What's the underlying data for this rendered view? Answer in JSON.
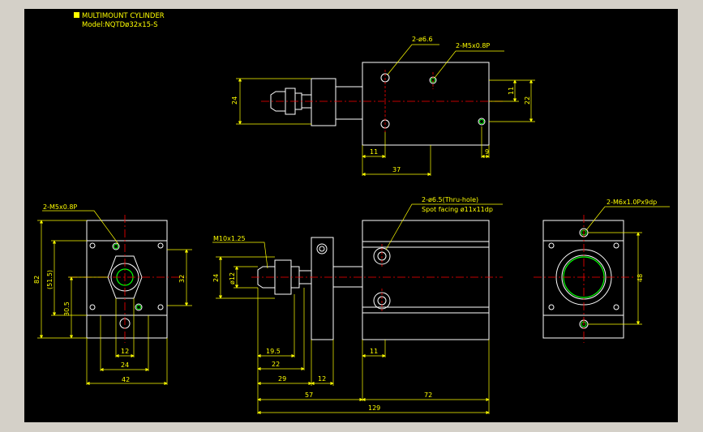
{
  "title": {
    "line1": "MULTIMOUNT CYLINDER",
    "line2": "Model:NQTDø32x15-S"
  },
  "colors": {
    "background": "#000000",
    "outline": "#ffffff",
    "dimension": "#ffff00",
    "centerline": "#ff0000",
    "highlight": "#00ff00",
    "window": "#d4d0c8"
  },
  "top_view": {
    "callout_holes": "2-ø6.6",
    "callout_threads": "2-M5x0.8P",
    "dims": {
      "height_24": "24",
      "d11": "11",
      "d22": "22",
      "left_11": "11",
      "right_9": "9",
      "d37": "37"
    }
  },
  "left_view": {
    "callout": "2-M5x0.8P",
    "dims": {
      "d82": "82",
      "d51_5": "(51.5)",
      "d30_5": "30.5",
      "d32": "32",
      "d12": "12",
      "d24": "24",
      "d42": "42"
    }
  },
  "front_view": {
    "callout_thread": "M10x1.25",
    "callout_holes": "2-ø6.5(Thru-hole)",
    "callout_spot": "Spot facing ø11x11dp",
    "dims": {
      "d24": "24",
      "d12": "ø12",
      "d19_5": "19.5",
      "d22": "22",
      "d29": "29",
      "d12b": "12",
      "d11": "11",
      "d57": "57",
      "d72": "72",
      "d129": "129"
    }
  },
  "right_view": {
    "callout": "2-M6x1.0Px9dp",
    "dims": {
      "d48": "48"
    }
  }
}
